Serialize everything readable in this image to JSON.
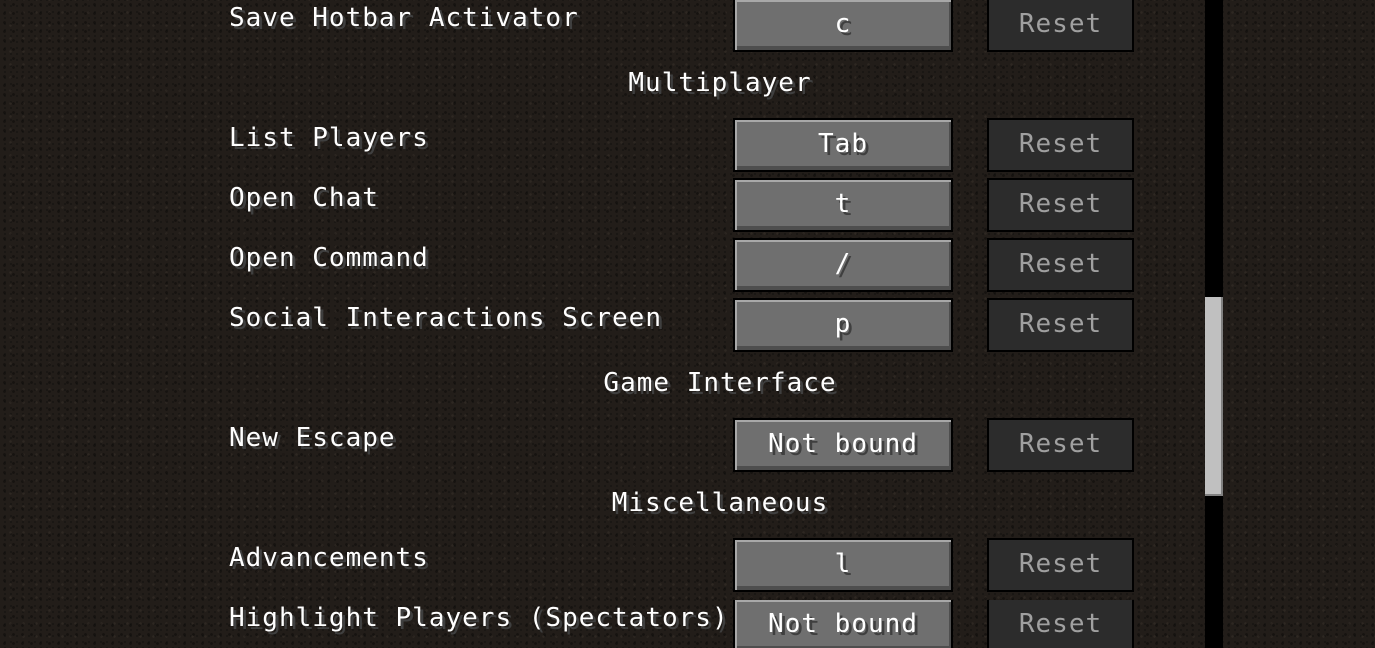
{
  "keybinds": {
    "rows": [
      {
        "kind": "bind",
        "label": "Save Hotbar Activator",
        "key": "c",
        "reset": "Reset"
      },
      {
        "kind": "heading",
        "label": "Multiplayer"
      },
      {
        "kind": "bind",
        "label": "List Players",
        "key": "Tab",
        "reset": "Reset"
      },
      {
        "kind": "bind",
        "label": "Open Chat",
        "key": "t",
        "reset": "Reset"
      },
      {
        "kind": "bind",
        "label": "Open Command",
        "key": "/",
        "reset": "Reset"
      },
      {
        "kind": "bind",
        "label": "Social Interactions Screen",
        "key": "p",
        "reset": "Reset"
      },
      {
        "kind": "heading",
        "label": "Game Interface"
      },
      {
        "kind": "bind",
        "label": "New Escape",
        "key": "Not bound",
        "reset": "Reset"
      },
      {
        "kind": "heading",
        "label": "Miscellaneous"
      },
      {
        "kind": "bind",
        "label": "Advancements",
        "key": "l",
        "reset": "Reset"
      },
      {
        "kind": "bind",
        "label": "Highlight Players (Spectators)",
        "key": "Not bound",
        "reset": "Reset"
      }
    ]
  },
  "colors": {
    "background": "#221d19",
    "key_button": "#6f6f6f",
    "reset_button_disabled": "#2c2c2c",
    "reset_text_disabled": "#a0a0a0",
    "scroll_thumb": "#c0c0c0"
  }
}
